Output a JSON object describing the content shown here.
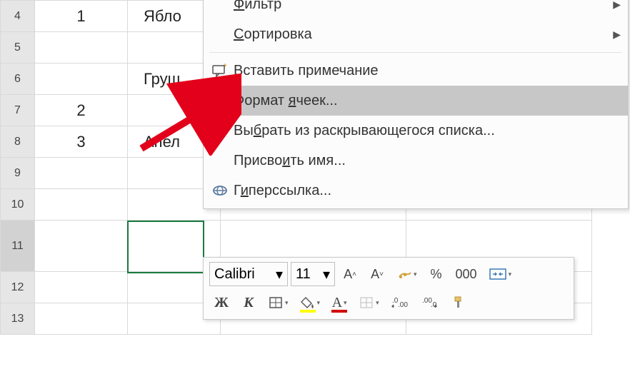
{
  "rows": {
    "r4": "4",
    "r5": "5",
    "r6": "6",
    "r7": "7",
    "r8": "8",
    "r9": "9",
    "r10": "10",
    "r11": "11",
    "r12": "12",
    "r13": "13"
  },
  "cells": {
    "A4": "1",
    "A7": "2",
    "A8": "3",
    "B4": "Ябло",
    "B6": "Груш",
    "B8": "Апел"
  },
  "menu": {
    "filter": "Фильтр",
    "sort": "Сортировка",
    "insert_comment": "Вставить примечание",
    "format_cells": "Формат ячеек...",
    "pick_from_list": "Выбрать из раскрывающегося списка...",
    "define_name": "Присвоить имя...",
    "hyperlink": "Гиперссылка..."
  },
  "underlines": {
    "filter": "Ф",
    "sort": "С",
    "format": "я",
    "pick": "б",
    "name": "и",
    "link": "и"
  },
  "toolbar": {
    "font_name": "Calibri",
    "font_size": "11",
    "bold": "Ж",
    "italic": "К",
    "percent": "%",
    "thousands": "000"
  }
}
